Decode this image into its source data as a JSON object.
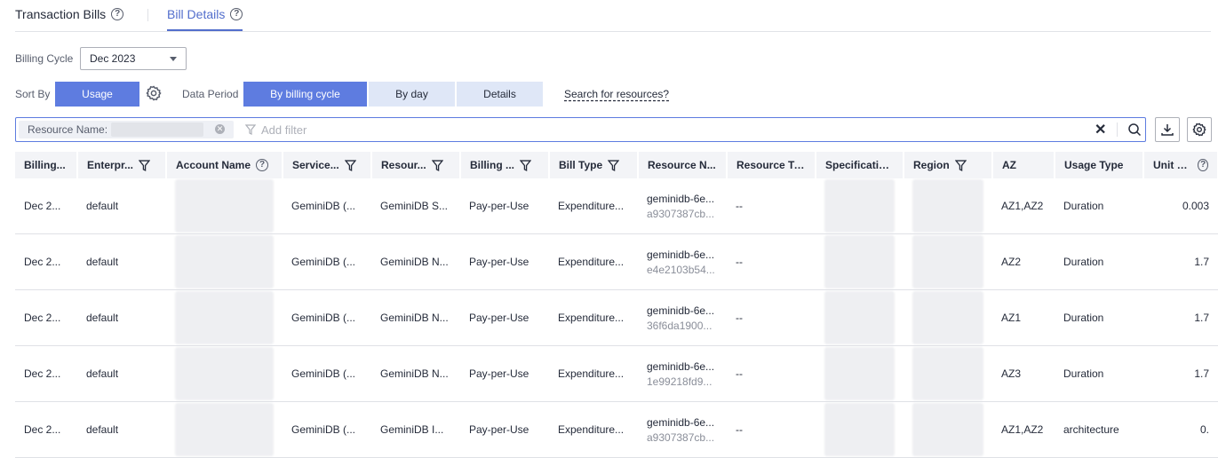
{
  "tabs": [
    {
      "label": "Transaction Bills",
      "active": false
    },
    {
      "label": "Bill Details",
      "active": true
    }
  ],
  "billing_cycle": {
    "label": "Billing Cycle",
    "value": "Dec 2023"
  },
  "sort_by": {
    "label": "Sort By",
    "value": "Usage"
  },
  "data_period": {
    "label": "Data Period",
    "options": [
      "By billing cycle",
      "By day",
      "Details"
    ],
    "selected": "By billing cycle"
  },
  "search_link": "Search for resources?",
  "filter": {
    "chip_label": "Resource Name:",
    "placeholder": "Add filter"
  },
  "columns": [
    "Billing...",
    "Enterpr...",
    "Account Name",
    "Service...",
    "Resour...",
    "Billing ...",
    "Bill Type",
    "Resource N...",
    "Resource Tag",
    "Specificatio...",
    "Region",
    "AZ",
    "Usage Type",
    "Unit Price"
  ],
  "rows": [
    {
      "billing": "Dec 2...",
      "enterprise": "default",
      "service": "GeminiDB (...",
      "resource_type": "GeminiDB S...",
      "billing_mode": "Pay-per-Use",
      "bill_type": "Expenditure...",
      "res_name": "geminidb-6e...",
      "res_id": "a9307387cb...",
      "tag": "--",
      "az": "AZ1,AZ2",
      "usage_type": "Duration",
      "unit_price": "0.003"
    },
    {
      "billing": "Dec 2...",
      "enterprise": "default",
      "service": "GeminiDB (...",
      "resource_type": "GeminiDB N...",
      "billing_mode": "Pay-per-Use",
      "bill_type": "Expenditure...",
      "res_name": "geminidb-6e...",
      "res_id": "e4e2103b54...",
      "tag": "--",
      "az": "AZ2",
      "usage_type": "Duration",
      "unit_price": "1.7"
    },
    {
      "billing": "Dec 2...",
      "enterprise": "default",
      "service": "GeminiDB (...",
      "resource_type": "GeminiDB N...",
      "billing_mode": "Pay-per-Use",
      "bill_type": "Expenditure...",
      "res_name": "geminidb-6e...",
      "res_id": "36f6da1900...",
      "tag": "--",
      "az": "AZ1",
      "usage_type": "Duration",
      "unit_price": "1.7"
    },
    {
      "billing": "Dec 2...",
      "enterprise": "default",
      "service": "GeminiDB (...",
      "resource_type": "GeminiDB N...",
      "billing_mode": "Pay-per-Use",
      "bill_type": "Expenditure...",
      "res_name": "geminidb-6e...",
      "res_id": "1e99218fd9...",
      "tag": "--",
      "az": "AZ3",
      "usage_type": "Duration",
      "unit_price": "1.7"
    },
    {
      "billing": "Dec 2...",
      "enterprise": "default",
      "service": "GeminiDB (...",
      "resource_type": "GeminiDB I...",
      "billing_mode": "Pay-per-Use",
      "bill_type": "Expenditure...",
      "res_name": "geminidb-6e...",
      "res_id": "a9307387cb...",
      "tag": "--",
      "az": "AZ1,AZ2",
      "usage_type": "architecture",
      "unit_price": "0."
    }
  ],
  "colors": {
    "primary": "#5e7ce0",
    "segment": "#dfe7f7",
    "header_bg": "#f3f4f7",
    "tab_active": "#526ecc"
  }
}
